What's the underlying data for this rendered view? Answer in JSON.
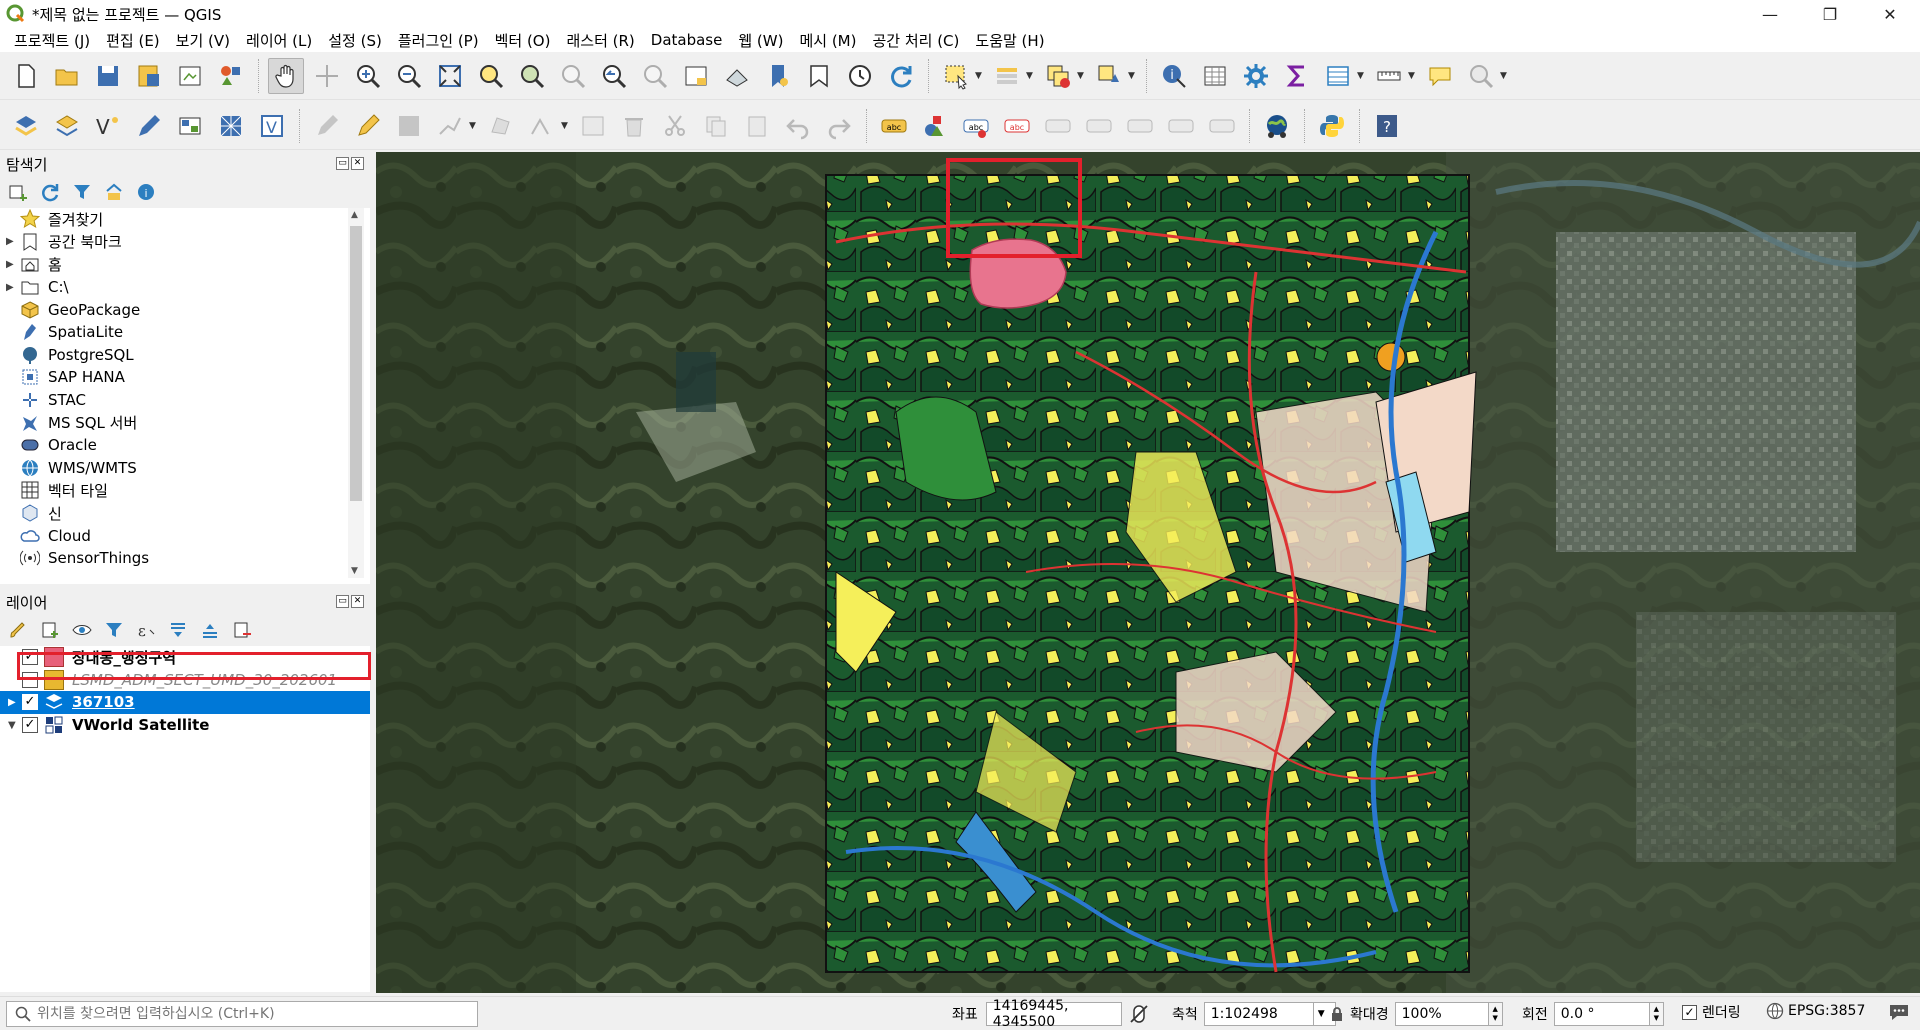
{
  "window": {
    "title": "*제목 없는 프로젝트 — QGIS",
    "minimize": "—",
    "restore": "❐",
    "close": "✕"
  },
  "menu": [
    "프로젝트 (J)",
    "편집 (E)",
    "보기 (V)",
    "레이어 (L)",
    "설정 (S)",
    "플러그인 (P)",
    "벡터 (O)",
    "래스터 (R)",
    "Database",
    "웹 (W)",
    "메시 (M)",
    "공간 처리 (C)",
    "도움말 (H)"
  ],
  "browser_panel": {
    "title": "탐색기",
    "items": [
      {
        "label": "즐겨찾기",
        "icon": "star-icon",
        "expandable": false
      },
      {
        "label": "공간 북마크",
        "icon": "bookmark-icon",
        "expandable": true
      },
      {
        "label": "홈",
        "icon": "home-folder-icon",
        "expandable": true
      },
      {
        "label": "C:\\",
        "icon": "folder-icon",
        "expandable": true
      },
      {
        "label": "GeoPackage",
        "icon": "geopackage-icon",
        "expandable": false
      },
      {
        "label": "SpatiaLite",
        "icon": "spatialite-icon",
        "expandable": false
      },
      {
        "label": "PostgreSQL",
        "icon": "postgresql-icon",
        "expandable": false
      },
      {
        "label": "SAP HANA",
        "icon": "sap-hana-icon",
        "expandable": false
      },
      {
        "label": "STAC",
        "icon": "stac-icon",
        "expandable": false
      },
      {
        "label": "MS SQL 서버",
        "icon": "mssql-icon",
        "expandable": false
      },
      {
        "label": "Oracle",
        "icon": "oracle-icon",
        "expandable": false
      },
      {
        "label": "WMS/WMTS",
        "icon": "wms-icon",
        "expandable": false
      },
      {
        "label": "벡터 타일",
        "icon": "vector-tile-icon",
        "expandable": false
      },
      {
        "label": "신",
        "icon": "scene-icon",
        "expandable": false
      },
      {
        "label": "Cloud",
        "icon": "cloud-icon",
        "expandable": false
      },
      {
        "label": "SensorThings",
        "icon": "sensorthings-icon",
        "expandable": false
      }
    ]
  },
  "layers_panel": {
    "title": "레이어",
    "layers": [
      {
        "name": "장대동_행정구역",
        "checked": true,
        "color": "#e8607a",
        "style": "bold",
        "selected": false
      },
      {
        "name": "LSMD_ADM_SECT_UMD_30_202601",
        "checked": false,
        "color": "#e8b830",
        "style": "italic",
        "selected": false
      },
      {
        "name": "367103",
        "checked": true,
        "color": "raster",
        "style": "bold",
        "selected": true
      },
      {
        "name": "VWorld Satellite",
        "checked": true,
        "color": "tile",
        "style": "bold",
        "selected": false
      }
    ]
  },
  "status": {
    "locator_placeholder": "위치를 찾으려면 입력하십시오 (Ctrl+K)",
    "coord_label": "좌표",
    "coord_value": "14169445, 4345500",
    "scale_label": "축척",
    "scale_value": "1:102498",
    "magnifier_label": "확대경",
    "magnifier_value": "100%",
    "rotation_label": "회전",
    "rotation_value": "0.0 °",
    "render_label": "렌더링",
    "crs": "EPSG:3857"
  },
  "colors": {
    "selection": "#0078d7",
    "highlight": "#e3202c",
    "admin_polygon": "#e8748e"
  }
}
